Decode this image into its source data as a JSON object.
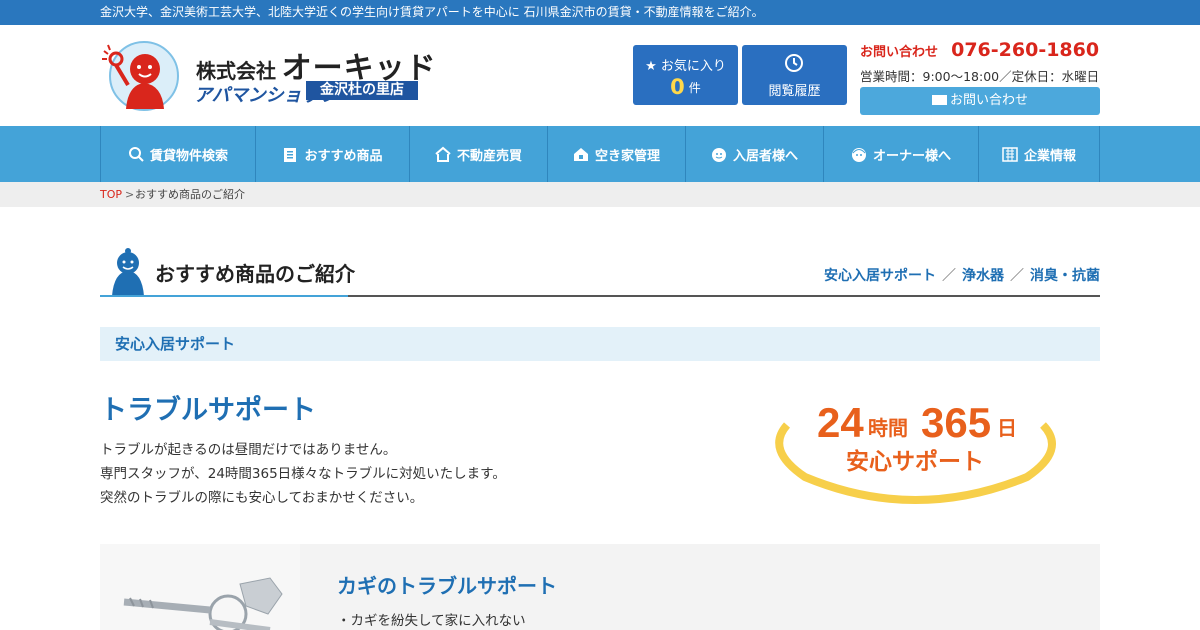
{
  "topbar": {
    "text": "金沢大学、金沢美術工芸大学、北陸大学近くの学生向け賃貸アパートを中心に 石川県金沢市の賃貸・不動産情報をご紹介。"
  },
  "header": {
    "logo": {
      "company_prefix": "株式会社",
      "company_name": "オーキッド",
      "brand": "アパマンショップ",
      "branch": "金沢杜の里店"
    },
    "favorites": {
      "label": "お気に入り",
      "count": "0",
      "unit": "件"
    },
    "history": {
      "label": "閲覧履歴"
    },
    "contact": {
      "label": "お問い合わせ",
      "tel": "076-260-1860",
      "hours": "営業時間：9:00〜18:00／定休日：水曜日",
      "button": "お問い合わせ"
    }
  },
  "nav": [
    {
      "label": "賃貸物件検索",
      "icon": "search-icon"
    },
    {
      "label": "おすすめ商品",
      "icon": "clipboard-icon"
    },
    {
      "label": "不動産売買",
      "icon": "house-icon"
    },
    {
      "label": "空き家管理",
      "icon": "home-lock-icon"
    },
    {
      "label": "入居者様へ",
      "icon": "resident-face-icon"
    },
    {
      "label": "オーナー様へ",
      "icon": "owner-face-icon"
    },
    {
      "label": "企業情報",
      "icon": "building-icon"
    }
  ],
  "breadcrumb": {
    "top": "TOP",
    "separator": ">",
    "current": "おすすめ商品のご紹介"
  },
  "page": {
    "title": "おすすめ商品のご紹介",
    "anchors": [
      "安心入居サポート",
      "浄水器",
      "消臭・抗菌"
    ],
    "anchor_separator": "／"
  },
  "section": {
    "heading": "安心入居サポート",
    "title": "トラブルサポート",
    "lines": [
      "トラブルが起きるのは昼間だけではありません。",
      "専門スタッフが、24時間365日様々なトラブルに対処いたします。",
      "突然のトラブルの際にも安心しておまかせください。"
    ],
    "badge": {
      "hours_num": "24",
      "hours_unit": "時間",
      "days_num": "365",
      "days_unit": "日",
      "caption": "安心サポート"
    }
  },
  "card": {
    "title": "カギのトラブルサポート",
    "item": "・カギを紛失して家に入れない"
  },
  "colors": {
    "brand_blue": "#2a77be",
    "nav_blue": "#44a3d8",
    "accent_red": "#d9261c",
    "badge_orange": "#e8601c",
    "badge_yellow": "#f7cf4a"
  }
}
